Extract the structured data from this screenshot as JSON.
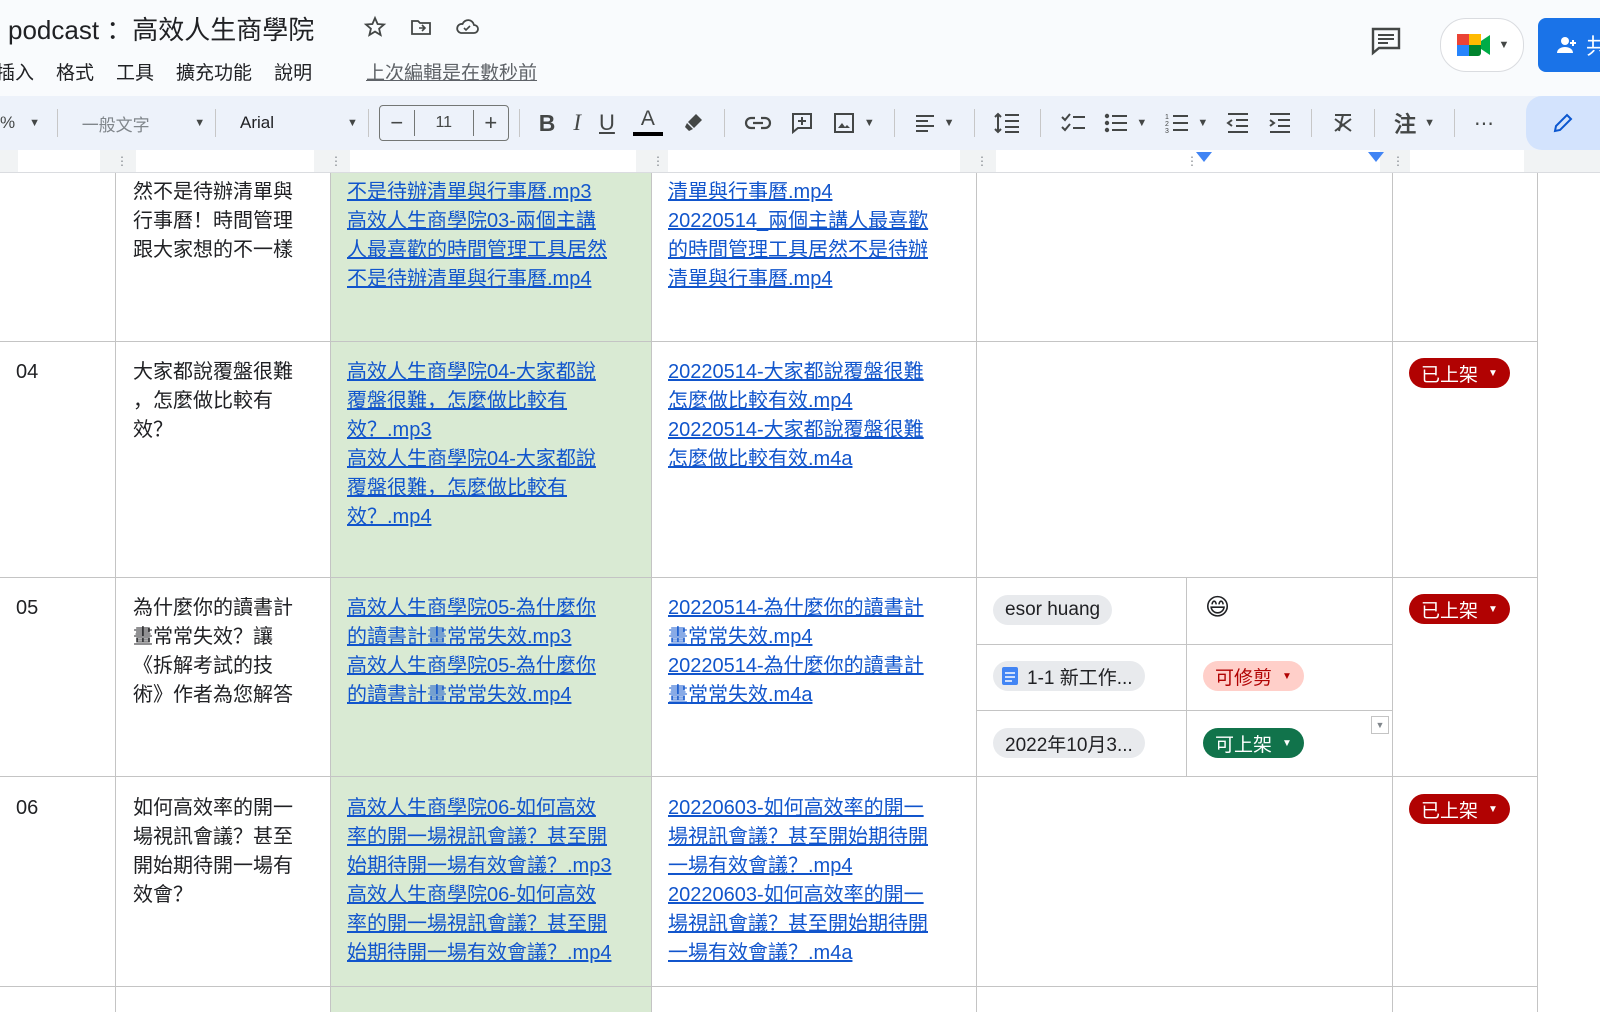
{
  "header": {
    "doc_title": "podcast ：高效人生商學院",
    "last_edit": "上次編輯是在數秒前",
    "share_label": "共"
  },
  "menu": [
    "插入",
    "格式",
    "工具",
    "擴充功能",
    "說明"
  ],
  "toolbar": {
    "zoom": "%",
    "style": "一般文字",
    "font": "Arial",
    "font_size": "11",
    "input_tools": "注"
  },
  "table": {
    "rows": [
      {
        "num": "",
        "title": [
          "然不是待辦清單與",
          "行事曆！時間管理",
          "跟大家想的不一樣"
        ],
        "col3": [
          "不是待辦清單與行事曆.mp3",
          "高效人生商學院03-兩個主講",
          "人最喜歡的時間管理工具居然",
          "不是待辦清單與行事曆.mp4"
        ],
        "col4": [
          "清單與行事曆.mp4",
          "20220514_兩個主講人最喜歡",
          "的時間管理工具居然不是待辦",
          "清單與行事曆.mp4"
        ],
        "status": ""
      },
      {
        "num": "04",
        "title": [
          "大家都說覆盤很難",
          "，怎麼做比較有",
          "效？"
        ],
        "col3": [
          "高效人生商學院04-大家都說",
          "覆盤很難，怎麼做比較有",
          "效？.mp3",
          "高效人生商學院04-大家都說",
          "覆盤很難，怎麼做比較有",
          "效？.mp4"
        ],
        "col4": [
          "20220514-大家都說覆盤很難",
          "怎麼做比較有效.mp4",
          "20220514-大家都說覆盤很難",
          "怎麼做比較有效.m4a"
        ],
        "status": "已上架"
      },
      {
        "num": "05",
        "title": [
          "為什麼你的讀書計",
          "畫常常失效？讓",
          "《拆解考試的技",
          "術》作者為您解答"
        ],
        "col3": [
          "高效人生商學院05-為什麼你",
          "的讀書計畫常常失效.mp3",
          "高效人生商學院05-為什麼你",
          "的讀書計畫常常失效.mp4"
        ],
        "col4": [
          "20220514-為什麼你的讀書計",
          "畫常常失效.mp4",
          "20220514-為什麼你的讀書計",
          "畫常常失效.m4a"
        ],
        "status": "已上架",
        "sub": {
          "person": "esor huang",
          "emoji": "😄",
          "file": "1-1 新工作...",
          "edit_status": "可修剪",
          "date": "2022年10月3...",
          "publish_status": "可上架"
        }
      },
      {
        "num": "06",
        "title": [
          "如何高效率的開一",
          "場視訊會議？甚至",
          "開始期待開一場有",
          "效會？"
        ],
        "col3": [
          "高效人生商學院06-如何高效",
          "率的開一場視訊會議？甚至開",
          "始期待開一場有效會議？.mp3",
          "高效人生商學院06-如何高效",
          "率的開一場視訊會議？甚至開",
          "始期待開一場有效會議？.mp4"
        ],
        "col4": [
          "20220603-如何高效率的開一",
          "場視訊會議？甚至開始期待開",
          "一場有效會議？.mp4",
          "20220603-如何高效率的開一",
          "場視訊會議？甚至開始期待開",
          "一場有效會議？.m4a"
        ],
        "status": "已上架"
      }
    ]
  },
  "colors": {
    "link": "#1155cc",
    "green_fill": "#d9ead3",
    "red_chip": "#b10202",
    "pink_chip": "#ffcfc9",
    "green_chip": "#11734b",
    "accent": "#1a73e8"
  }
}
